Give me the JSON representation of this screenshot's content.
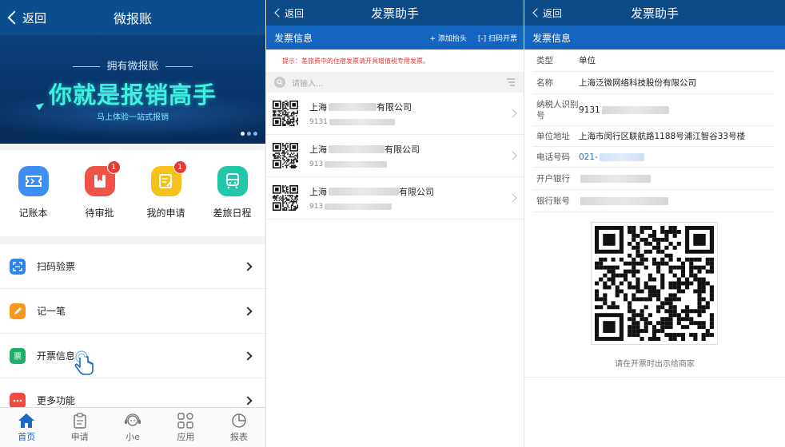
{
  "panel1": {
    "nav": {
      "back": "返回",
      "title": "微报账"
    },
    "banner": {
      "subtitle": "拥有微报账",
      "headline": "你就是报销高手",
      "tagline": "马上体验一站式报销"
    },
    "quick": [
      {
        "label": "记账本",
        "color": "#3d8ef0",
        "badge": ""
      },
      {
        "label": "待审批",
        "color": "#f0524a",
        "badge": "1"
      },
      {
        "label": "我的申请",
        "color": "#f5c21b",
        "badge": "1"
      },
      {
        "label": "差旅日程",
        "color": "#22c7a9",
        "badge": ""
      }
    ],
    "menu": [
      {
        "label": "扫码验票",
        "color": "#2f86e8",
        "icon": "scan-icon"
      },
      {
        "label": "记一笔",
        "color": "#f39a1e",
        "icon": "pencil-icon"
      },
      {
        "label": "开票信息",
        "color": "#1fae6a",
        "icon": "invoice-icon",
        "glyph": "票"
      },
      {
        "label": "更多功能",
        "color": "#ef4b3f",
        "icon": "more-icon"
      }
    ],
    "tabs": [
      {
        "label": "首页",
        "active": true
      },
      {
        "label": "申请",
        "active": false
      },
      {
        "label": "小e",
        "active": false
      },
      {
        "label": "应用",
        "active": false
      },
      {
        "label": "报表",
        "active": false
      }
    ]
  },
  "panel2": {
    "nav": {
      "back": "返回",
      "title": "发票助手"
    },
    "section_title": "发票信息",
    "add_header": "+ 添加抬头",
    "scan_invoice": "[-] 扫码开票",
    "tip": "提示：差旅费中的住宿发票请开具增值税专用发票。",
    "search_placeholder": "请输入...",
    "rows": [
      {
        "name_prefix": "上海",
        "name_suffix": "有限公司",
        "tax_prefix": "9131"
      },
      {
        "name_prefix": "上海",
        "name_suffix": "有限公司",
        "tax_prefix": "913"
      },
      {
        "name_prefix": "上海",
        "name_suffix": "有限公司",
        "tax_prefix": "913"
      }
    ]
  },
  "panel3": {
    "nav": {
      "back": "返回",
      "title": "发票助手"
    },
    "section_title": "发票信息",
    "fields": {
      "type_label": "类型",
      "type_value": "单位",
      "name_label": "名称",
      "name_value": "上海泛微网络科技股份有限公司",
      "tax_label": "纳税人识别号",
      "tax_value": "9131",
      "addr_label": "单位地址",
      "addr_value": "上海市闵行区联航路1188号浦江智谷33号楼",
      "phone_label": "电话号码",
      "phone_value": "021-",
      "bank_label": "开户银行",
      "account_label": "银行账号"
    },
    "qr_caption": "请在开票时出示给商家"
  }
}
